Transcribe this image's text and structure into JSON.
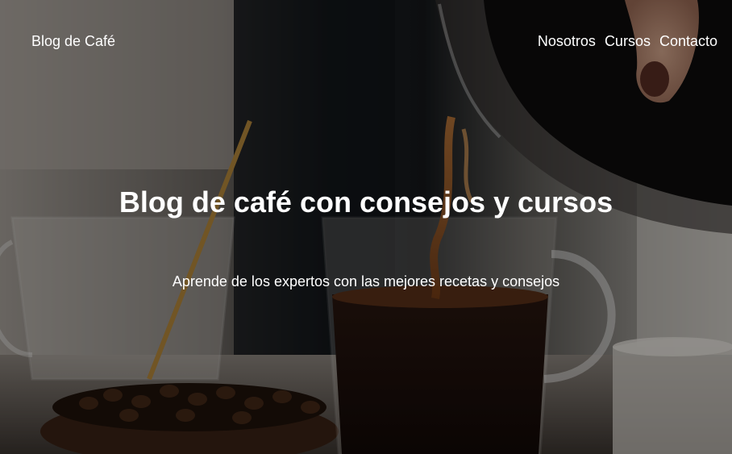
{
  "nav": {
    "brand": "Blog de Café",
    "links": [
      "Nosotros",
      "Cursos",
      "Contacto"
    ]
  },
  "hero": {
    "title": "Blog de café con consejos y cursos",
    "subtitle": "Aprende de los expertos con las mejores recetas y consejos"
  },
  "colors": {
    "text": "#ffffff",
    "overlay": "#000000",
    "coffee": "#2a1710",
    "background": "#1b1714"
  }
}
